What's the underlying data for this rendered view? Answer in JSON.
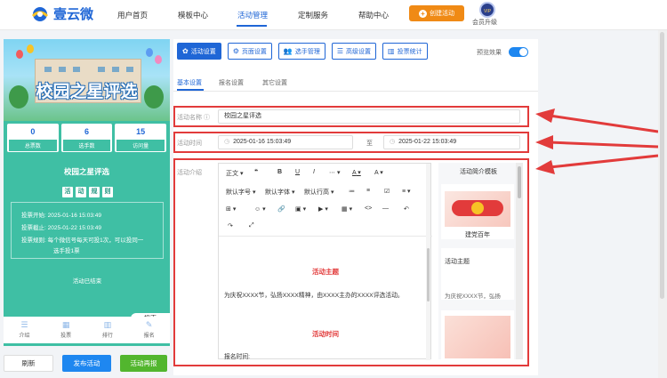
{
  "brand": {
    "name": "壹云微"
  },
  "nav": {
    "items": [
      "用户首页",
      "模板中心",
      "活动管理",
      "定制服务",
      "帮助中心"
    ],
    "create_label": "创建活动",
    "vip_badge": "VIP",
    "vip_label": "会员升级"
  },
  "preview": {
    "banner_title": "校园之星评选",
    "stats": [
      {
        "value": "0",
        "label": "总票数"
      },
      {
        "value": "6",
        "label": "选手数"
      },
      {
        "value": "15",
        "label": "访问量"
      }
    ],
    "activity_name": "校园之星评选",
    "rules_chars": [
      "活",
      "动",
      "规",
      "则"
    ],
    "rules": [
      "投票开始: 2025-01-16 15:03:49",
      "投票截止: 2025-01-22 15:03:49",
      "投票规则: 每个微信号每天可投1次，可以投同一",
      "选手投1票"
    ],
    "ended_text": "活动已结束",
    "search_label": "搜索",
    "tabs": [
      {
        "icon": "☰",
        "label": "介绍"
      },
      {
        "icon": "▦",
        "label": "投票"
      },
      {
        "icon": "▥",
        "label": "排行"
      },
      {
        "icon": "✎",
        "label": "报名"
      }
    ]
  },
  "actions": {
    "refresh": "刷新",
    "publish": "发布活动",
    "preview": "活动再报"
  },
  "toolbar": {
    "buttons": [
      "活动设置",
      "页面设置",
      "选手管理",
      "高级设置",
      "投票统计"
    ],
    "preview_toggle_label": "预览效果",
    "preview_on": true
  },
  "subtabs": [
    "基本设置",
    "报名设置",
    "其它设置"
  ],
  "form": {
    "name_label": "活动名称",
    "name_value": "校园之星评选",
    "time_label": "活动时间",
    "start": "2025-01-16 15:03:49",
    "to": "至",
    "end": "2025-01-22 15:03:49",
    "intro_label": "活动介绍"
  },
  "editor": {
    "tools_row1": [
      "正文",
      "❝",
      "B",
      "U",
      "I",
      "⋯",
      "A",
      "A"
    ],
    "tools_row2": [
      "默认字号",
      "默认字体",
      "默认行高",
      "≔",
      "≡",
      "☑",
      "≡"
    ],
    "tools_row3": [
      "⊞",
      "☺",
      "🔗",
      "▣",
      "▶",
      "▦",
      "<>",
      "—",
      "↶"
    ],
    "tools_row4": [
      "↷",
      "⤢"
    ],
    "content": {
      "h1": "活动主题",
      "p1": "为庆祝XXXX节，弘扬XXXX精神，由XXXX主办的XXXX评选活动。",
      "h2": "活动时间",
      "p2": "报名时间:"
    }
  },
  "templates": {
    "title": "活动简介模板",
    "card1_caption": "建党百年",
    "card2_title": "活动主题",
    "card2_text": "为庆祝XXXX节，弘扬"
  }
}
